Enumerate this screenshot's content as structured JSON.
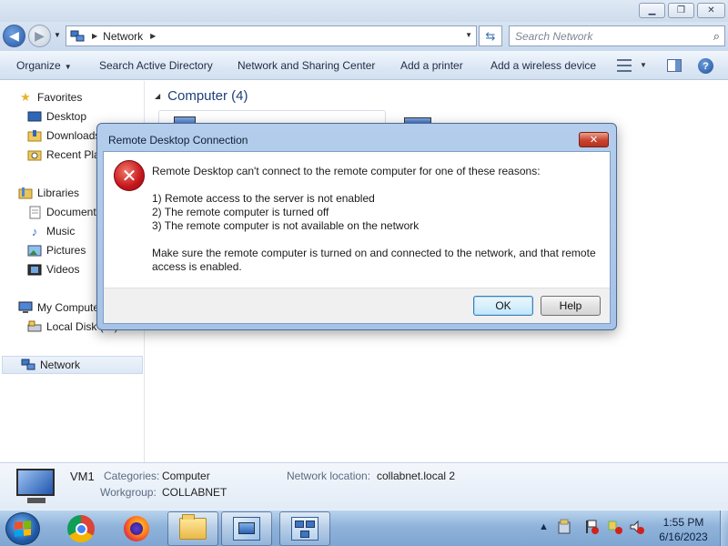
{
  "window": {
    "caption_buttons": {
      "minimize_icon": "minimize-icon",
      "maximize_icon": "restore-icon",
      "close_icon": "close-icon"
    }
  },
  "address_bar": {
    "breadcrumb": "Network",
    "search_placeholder": "Search Network"
  },
  "command_bar": {
    "organize": "Organize",
    "search_ad": "Search Active Directory",
    "network_sharing": "Network and Sharing Center",
    "add_printer": "Add a printer",
    "add_wireless": "Add a wireless device"
  },
  "nav_pane": {
    "favorites": "Favorites",
    "desktop": "Desktop",
    "downloads": "Downloads",
    "recent_places": "Recent Places",
    "libraries": "Libraries",
    "documents": "Documents",
    "music": "Music",
    "pictures": "Pictures",
    "videos": "Videos",
    "my_computer": "My Computer",
    "local_disk": "Local Disk (C:)",
    "network": "Network"
  },
  "content": {
    "group_header": "Computer (4)"
  },
  "details_pane": {
    "name": "VM1",
    "categories_label": "Categories:",
    "categories_value": "Computer",
    "workgroup_label": "Workgroup:",
    "workgroup_value": "COLLABNET",
    "location_label": "Network location:",
    "location_value": "collabnet.local  2"
  },
  "dialog": {
    "title": "Remote Desktop Connection",
    "intro": "Remote Desktop can't connect to the remote computer for one of these reasons:",
    "reason1": "1) Remote access to the server is not enabled",
    "reason2": "2) The remote computer is turned off",
    "reason3": "3) The remote computer is not available on the network",
    "advice_line1": "Make sure the remote computer is turned on and connected to the network, and that remote",
    "advice_line2": "access is enabled.",
    "ok_label": "OK",
    "help_label": "Help",
    "icon": "error-icon"
  },
  "taskbar": {
    "time": "1:55 PM",
    "date": "6/16/2023"
  },
  "colors": {
    "accent": "#1e3e7a",
    "error_red": "#c6151c",
    "taskbar": "#8fb3da"
  }
}
